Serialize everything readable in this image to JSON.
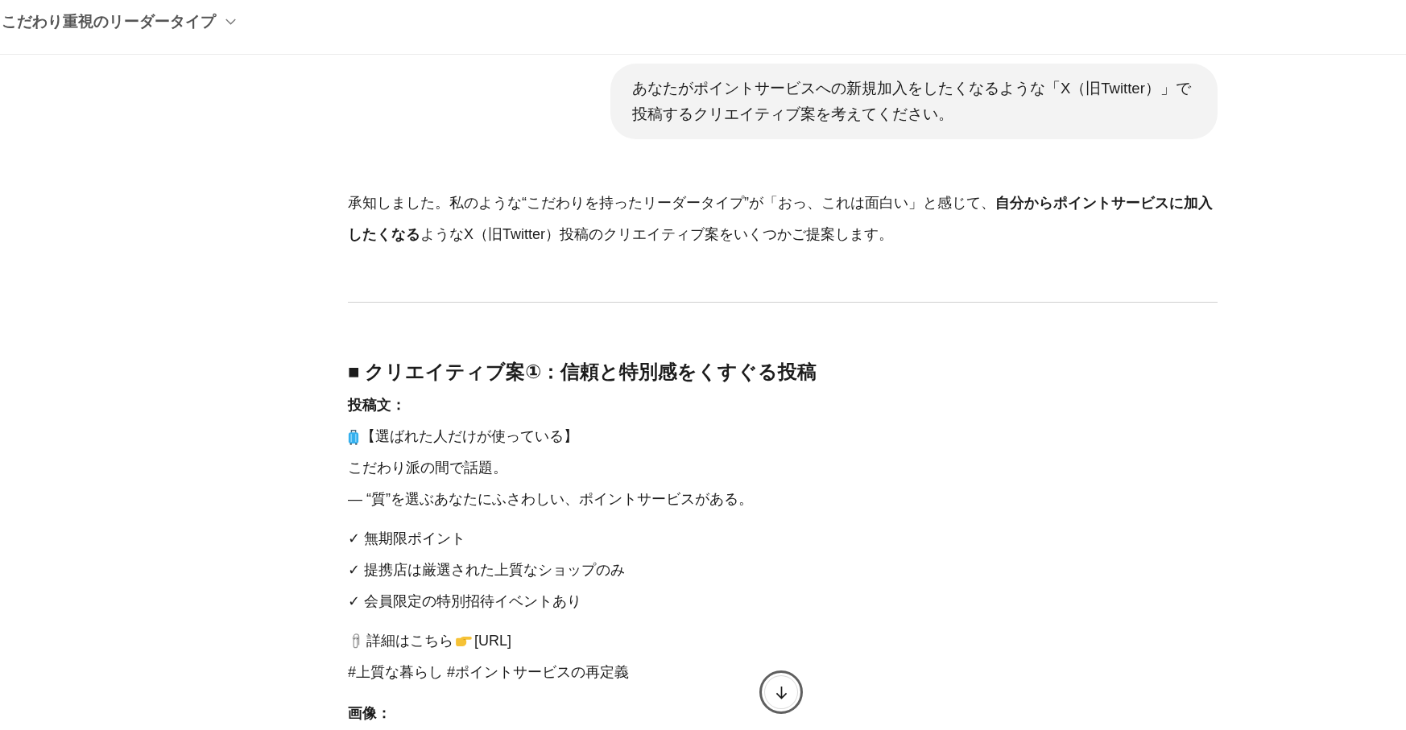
{
  "header": {
    "title": "こだわり重視のリーダータイプ"
  },
  "user_message": {
    "text": "あなたがポイントサービスへの新規加入をしたくなるような「X（旧Twitter）」で投稿するクリエイティブ案を考えてください。"
  },
  "assistant_message": {
    "intro": "承知しました。私のような“こだわりを持ったリーダータイプ”が「おっ、これは面白い」と感じて、**自分からポイントサービスに加入したくなる**ようなX（旧Twitter）投稿のクリエイティブ案をいくつかご提案します。",
    "section_heading": "■ クリエイティブ案①：信頼と特別感をくすぐる投稿",
    "post_label": "投稿文：",
    "post": {
      "headline": "【選ばれた人だけが使っている】",
      "lines": [
        "こだわり派の間で話題。",
        "— “質”を選ぶあなたにふさわしい、ポイントサービスがある。"
      ],
      "checklist": [
        "✓ 無期限ポイント",
        "✓ 提携店は厳選された上質なショップのみ",
        "✓ 会員限定の特別招待イベントあり"
      ],
      "details": {
        "text": "詳細はこちら",
        "link": "[URL]"
      },
      "hashtags": "#上質な暮らし #ポイントサービスの再定義"
    },
    "next_label": "画像："
  }
}
